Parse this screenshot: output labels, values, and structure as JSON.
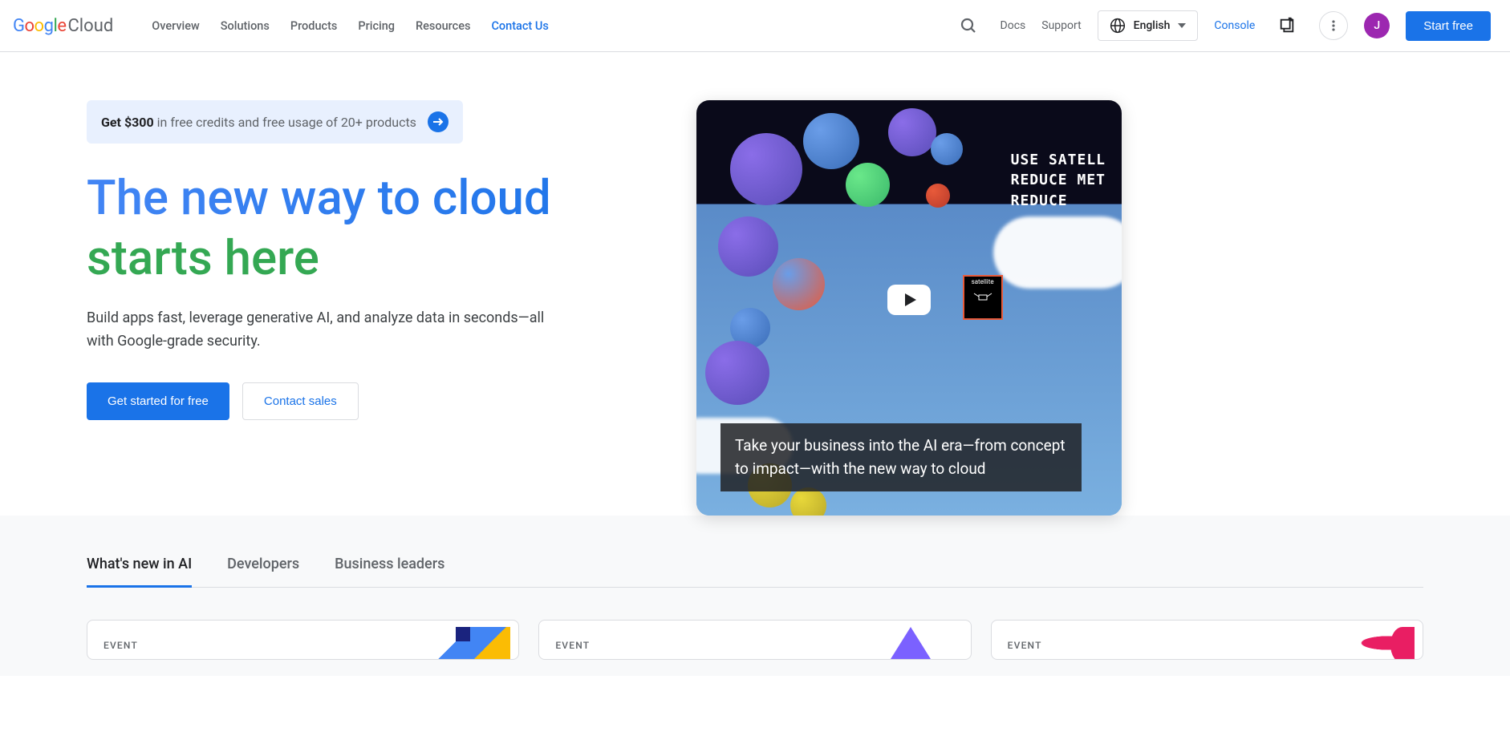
{
  "logo": {
    "cloud": "Cloud"
  },
  "nav": {
    "overview": "Overview",
    "solutions": "Solutions",
    "products": "Products",
    "pricing": "Pricing",
    "resources": "Resources",
    "contact": "Contact Us"
  },
  "header": {
    "docs": "Docs",
    "support": "Support",
    "language": "English",
    "console": "Console",
    "avatar_initial": "J",
    "start_free": "Start free"
  },
  "promo": {
    "bold": "Get $300",
    "rest": " in free credits and free usage of 20+ products"
  },
  "hero": {
    "title_line1": "The new way to cloud",
    "title_line2": "starts here",
    "desc": "Build apps fast, leverage generative AI, and analyze data in seconds—all with Google-grade security.",
    "cta_primary": "Get started for free",
    "cta_secondary": "Contact sales"
  },
  "video": {
    "top_text_l1": "USE SATELL",
    "top_text_l2": "REDUCE MET",
    "top_text_l3": "REDUCE",
    "satellite_label": "satellite",
    "caption": "Take your business into the AI era—from concept to impact—with the new way to cloud"
  },
  "tabs": {
    "ai": "What's new in AI",
    "developers": "Developers",
    "business": "Business leaders"
  },
  "cards": {
    "label": "EVENT"
  }
}
